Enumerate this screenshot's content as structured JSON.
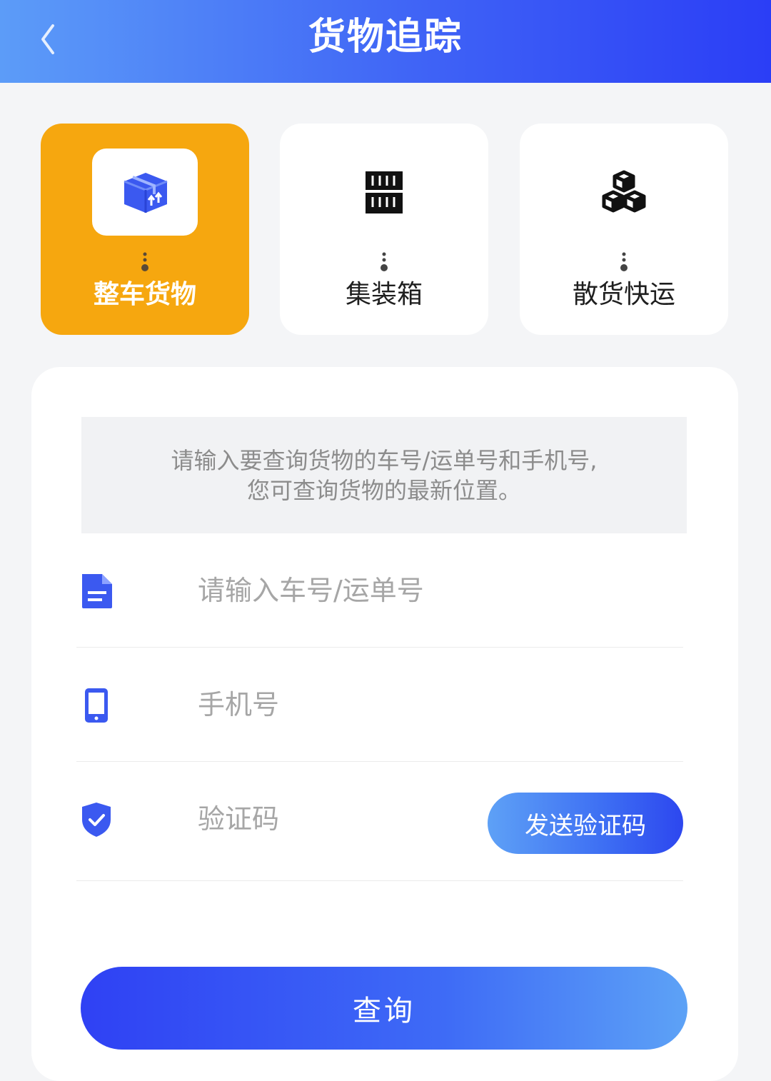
{
  "header": {
    "title": "货物追踪",
    "back_icon": "chevron-left-icon"
  },
  "categories": [
    {
      "label": "整车货物",
      "icon": "package-box-icon",
      "selected": true
    },
    {
      "label": "集装箱",
      "icon": "container-icon",
      "selected": false
    },
    {
      "label": "散货快运",
      "icon": "stacked-cubes-icon",
      "selected": false
    }
  ],
  "notice": {
    "line1": "请输入要查询货物的车号/运单号和手机号,",
    "line2": "您可查询货物的最新位置。"
  },
  "form": {
    "waybill": {
      "placeholder": "请输入车号/运单号",
      "icon": "document-icon",
      "value": ""
    },
    "phone": {
      "placeholder": "手机号",
      "icon": "phone-icon",
      "value": ""
    },
    "code": {
      "placeholder": "验证码",
      "icon": "shield-check-icon",
      "value": ""
    },
    "send_code_label": "发送验证码",
    "submit_label": "查询"
  },
  "colors": {
    "header_gradient": [
      "#5c9cf8",
      "#2b3ef6"
    ],
    "selected_card": "#f6a70f",
    "icon_blue": "#3b59f0"
  }
}
